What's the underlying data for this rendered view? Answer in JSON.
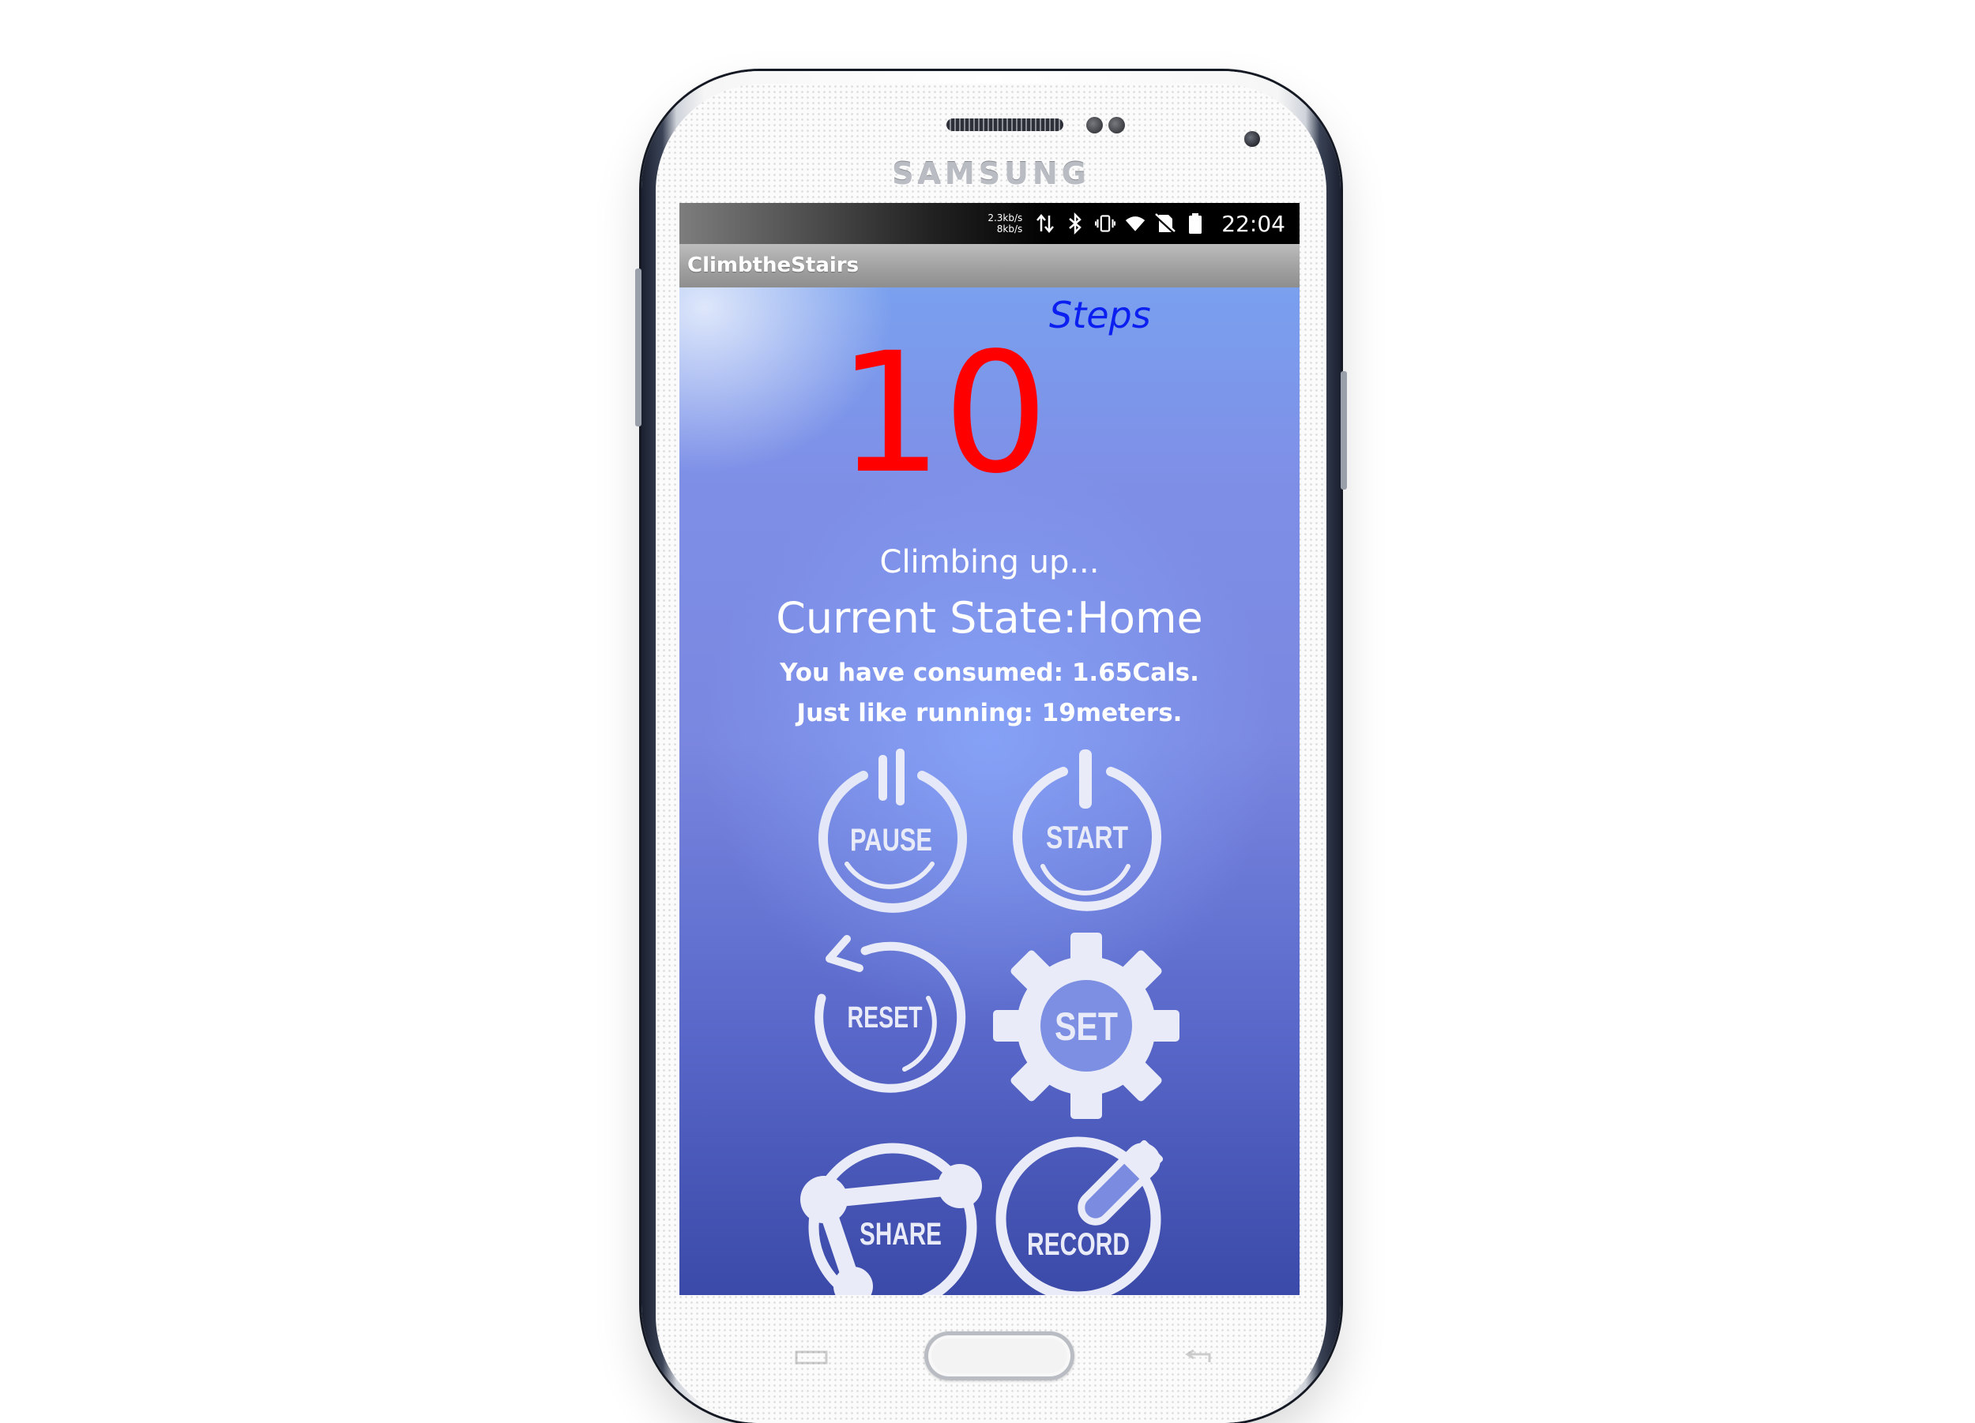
{
  "device": {
    "brand": "SAMSUNG"
  },
  "status_bar": {
    "net_speed_up": "2.3kb/s",
    "net_speed_down": "8kb/s",
    "time": "22:04",
    "icons": [
      "data-transfer-icon",
      "bluetooth-icon",
      "vibrate-icon",
      "wifi-icon",
      "no-sim-icon",
      "battery-icon"
    ]
  },
  "app": {
    "title": "ClimbtheStairs"
  },
  "steps": {
    "label": "Steps",
    "count": "10"
  },
  "state": {
    "activity": "Climbing up...",
    "current_state": "Current State:Home",
    "consumed": "You have consumed: 1.65Cals.",
    "running": "Just like running: 19meters."
  },
  "buttons": {
    "pause": "PAUSE",
    "start": "START",
    "reset": "RESET",
    "set": "SET",
    "share": "SHARE",
    "record": "RECORD"
  },
  "colors": {
    "step_count": "#ff0000",
    "steps_label": "#0a1ff0",
    "button_fill": "#e8ecf8"
  }
}
